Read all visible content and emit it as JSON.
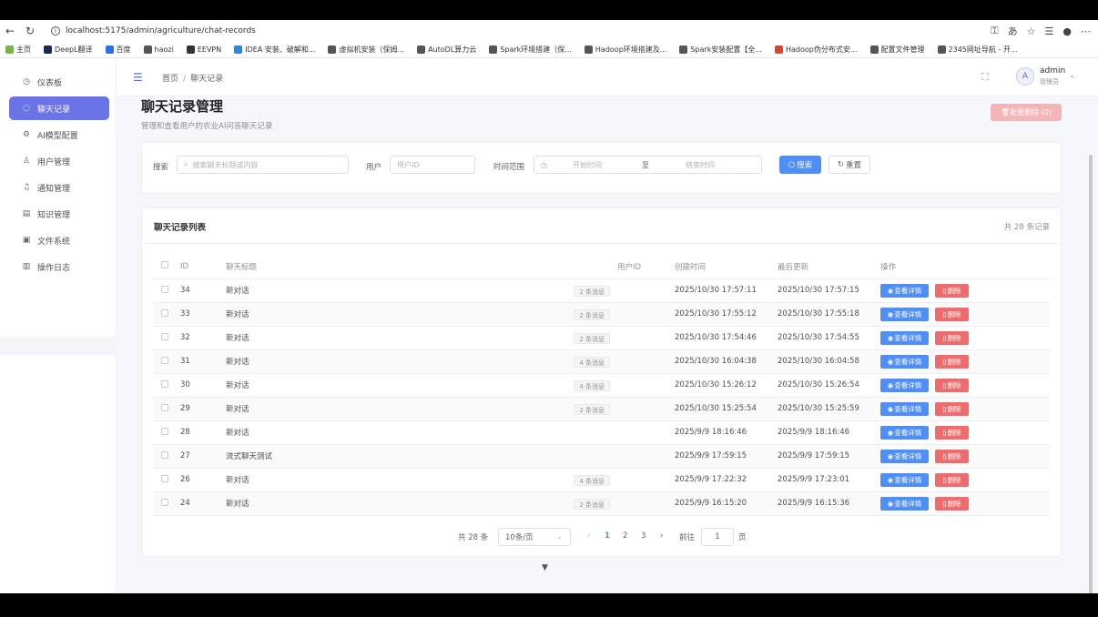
{
  "browser": {
    "url": "localhost:5175/admin/agriculture/chat-records",
    "bookmarks": [
      "主页",
      "DeepL翻译",
      "百度",
      "haozi",
      "EEVPN",
      "IDEA 安装、破解和...",
      "虚拟机安装（保姆...",
      "AutoDL算力云",
      "Spark环境搭建（保...",
      "Hadoop环境搭建及...",
      "Spark安装配置【全...",
      "Hadoop伪分布式安...",
      "配置文件管理",
      "2345网址导航 - 开..."
    ]
  },
  "sidebar": {
    "items": [
      {
        "label": "仪表板",
        "icon": "dashboard-icon"
      },
      {
        "label": "聊天记录",
        "icon": "chat-icon"
      },
      {
        "label": "AI模型配置",
        "icon": "gear-icon"
      },
      {
        "label": "用户管理",
        "icon": "user-icon"
      },
      {
        "label": "通知管理",
        "icon": "bell-icon"
      },
      {
        "label": "知识管理",
        "icon": "document-icon"
      },
      {
        "label": "文件系统",
        "icon": "folder-icon"
      },
      {
        "label": "操作日志",
        "icon": "log-icon"
      }
    ]
  },
  "header": {
    "breadcrumb": [
      "首页",
      "聊天记录"
    ],
    "user_initial": "A",
    "user_name": "admin",
    "user_role": "管理员"
  },
  "page": {
    "title": "聊天记录管理",
    "subtitle": "管理和查看用户的农业AI问答聊天记录",
    "batch_delete": "批量删除 (0)"
  },
  "search": {
    "search_label": "搜索",
    "search_placeholder": "搜索聊天标题或内容",
    "user_label": "用户",
    "user_placeholder": "用户ID",
    "time_label": "时间范围",
    "start_placeholder": "开始时间",
    "to": "至",
    "end_placeholder": "结束时间",
    "search_button": "搜索",
    "reset_button": "重置"
  },
  "list": {
    "title": "聊天记录列表",
    "total": "共 28 条记录",
    "columns": [
      "ID",
      "聊天标题",
      "用户ID",
      "创建时间",
      "最后更新",
      "操作"
    ],
    "view_label": "查看详情",
    "delete_label": "删除",
    "rows": [
      {
        "id": "34",
        "title": "新对话",
        "badge": "2 条消息",
        "user": "",
        "created": "2025/10/30 17:57:11",
        "updated": "2025/10/30 17:57:15"
      },
      {
        "id": "33",
        "title": "新对话",
        "badge": "2 条消息",
        "user": "",
        "created": "2025/10/30 17:55:12",
        "updated": "2025/10/30 17:55:18"
      },
      {
        "id": "32",
        "title": "新对话",
        "badge": "2 条消息",
        "user": "",
        "created": "2025/10/30 17:54:46",
        "updated": "2025/10/30 17:54:55"
      },
      {
        "id": "31",
        "title": "新对话",
        "badge": "4 条消息",
        "user": "",
        "created": "2025/10/30 16:04:38",
        "updated": "2025/10/30 16:04:58"
      },
      {
        "id": "30",
        "title": "新对话",
        "badge": "4 条消息",
        "user": "",
        "created": "2025/10/30 15:26:12",
        "updated": "2025/10/30 15:26:54"
      },
      {
        "id": "29",
        "title": "新对话",
        "badge": "2 条消息",
        "user": "",
        "created": "2025/10/30 15:25:54",
        "updated": "2025/10/30 15:25:59"
      },
      {
        "id": "28",
        "title": "新对话",
        "badge": "",
        "user": "",
        "created": "2025/9/9 18:16:46",
        "updated": "2025/9/9 18:16:46"
      },
      {
        "id": "27",
        "title": "流式聊天测试",
        "badge": "",
        "user": "",
        "created": "2025/9/9 17:59:15",
        "updated": "2025/9/9 17:59:15"
      },
      {
        "id": "26",
        "title": "新对话",
        "badge": "4 条消息",
        "user": "",
        "created": "2025/9/9 17:22:32",
        "updated": "2025/9/9 17:23:01"
      },
      {
        "id": "24",
        "title": "新对话",
        "badge": "2 条消息",
        "user": "",
        "created": "2025/9/9 16:15:20",
        "updated": "2025/9/9 16:15:36"
      }
    ]
  },
  "pagination": {
    "total": "共 28 条",
    "page_size": "10条/页",
    "pages": [
      "1",
      "2",
      "3"
    ],
    "current": "1",
    "goto_label": "前往",
    "goto_value": "1",
    "page_suffix": "页"
  },
  "colors": {
    "primary": "#4e8ef7",
    "sidebar_active": "#6b74e6",
    "danger": "#f06c6c"
  }
}
